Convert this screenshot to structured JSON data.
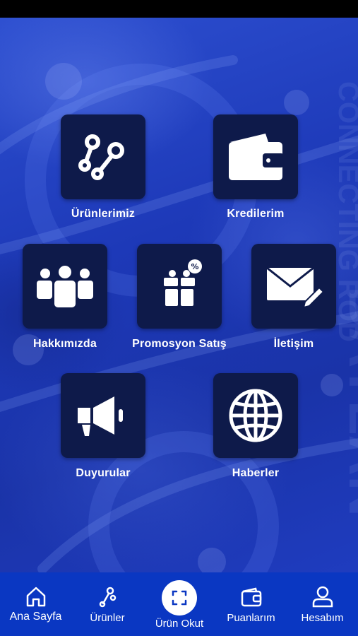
{
  "menu": {
    "products": "Ürünlerimiz",
    "credits": "Kredilerim",
    "about": "Hakkımızda",
    "promo": "Promosyon Satış",
    "contact": "İletişim",
    "announcements": "Duyurular",
    "news": "Haberler"
  },
  "nav": {
    "home": "Ana Sayfa",
    "products": "Ürünler",
    "scan": "Ürün Okut",
    "points": "Puanlarım",
    "account": "Hesabım"
  },
  "icons": {
    "products": "connecting-rod-icon",
    "credits": "wallet-icon",
    "about": "team-icon",
    "promo": "gift-discount-icon",
    "contact": "mail-pen-icon",
    "announcements": "megaphone-icon",
    "news": "globe-icon",
    "nav_home": "home-icon",
    "nav_products": "wrench-icon",
    "nav_scan": "scan-icon",
    "nav_points": "wallet-icon",
    "nav_account": "user-icon"
  },
  "colors": {
    "tile": "#0e1a4a",
    "nav_bar": "#0a37c2",
    "background": "#1d39b8"
  }
}
